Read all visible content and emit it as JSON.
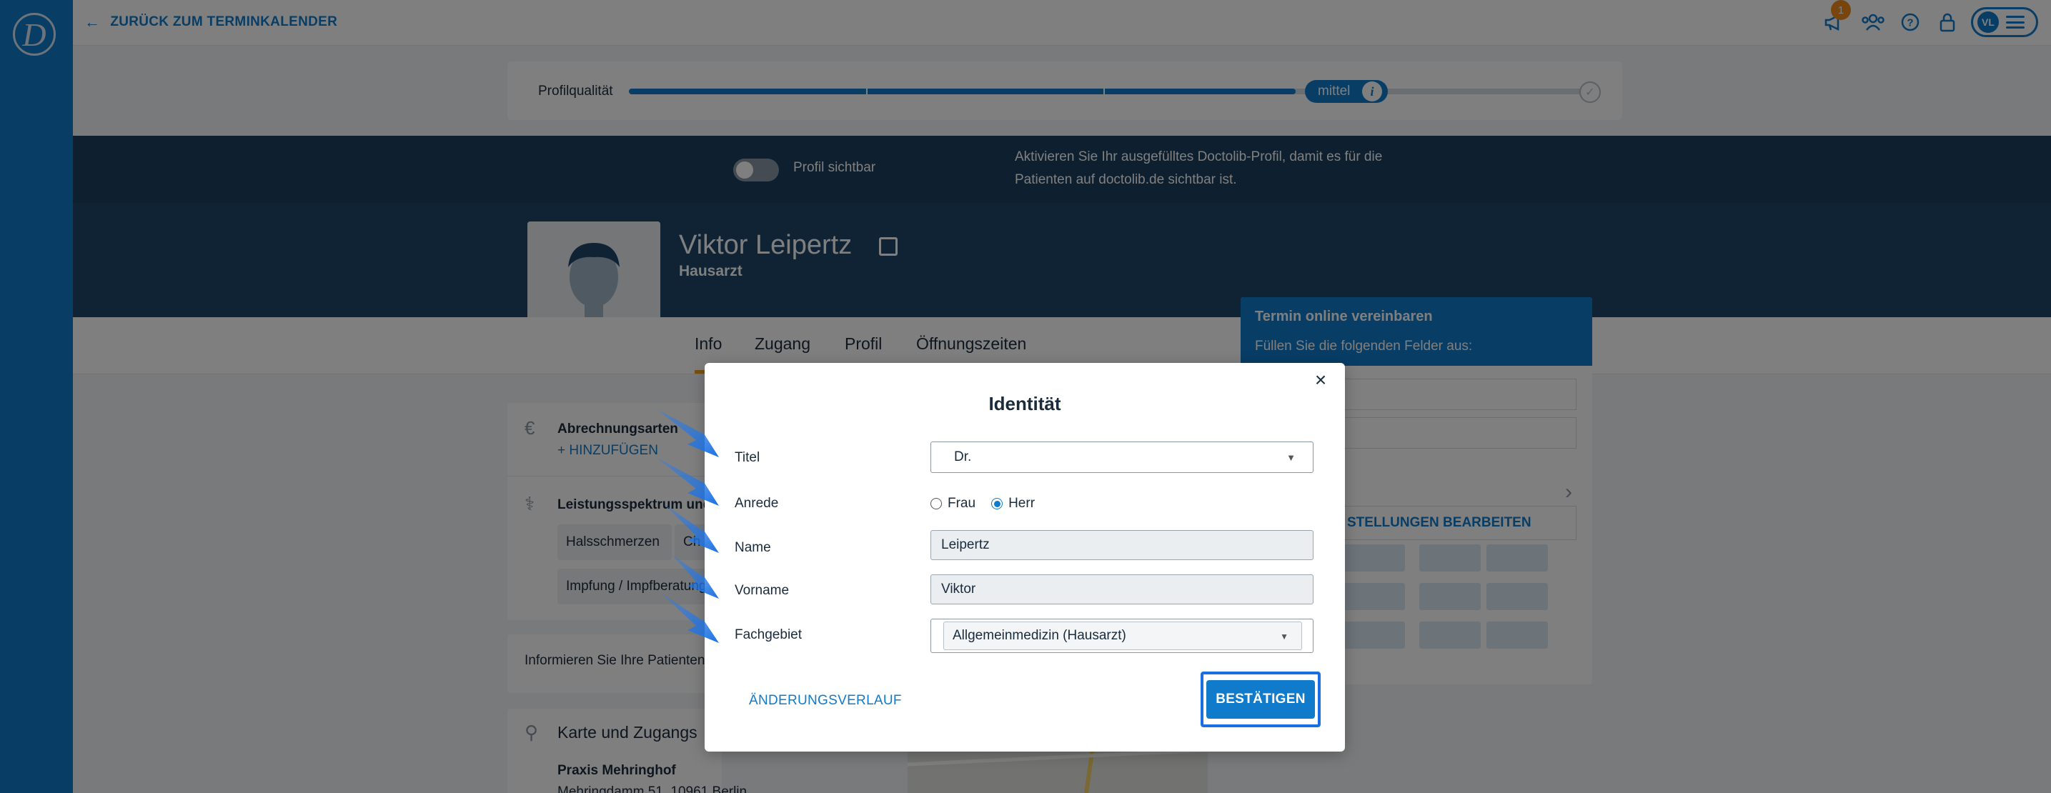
{
  "topbar": {
    "back_label": "ZURÜCK ZUM TERMINKALENDER",
    "notification_count": "1",
    "avatar_initials": "VL",
    "icons": [
      "megaphone-icon",
      "team-icon",
      "help-icon",
      "lock-icon",
      "menu-icon"
    ]
  },
  "quality": {
    "label": "Profilqualität",
    "level_text": "mittel",
    "level_fraction": 0.69
  },
  "visibility": {
    "toggle_label": "Profil sichtbar",
    "toggle_on": false,
    "info_text": "Aktivieren Sie Ihr ausgefülltes Doctolib-Profil, damit es für die Patienten auf doctolib.de sichtbar ist."
  },
  "profile": {
    "name": "Viktor Leipertz",
    "specialty": "Hausarzt"
  },
  "tabs": [
    "Info",
    "Zugang",
    "Profil",
    "Öffnungszeiten"
  ],
  "cards": {
    "billing_title": "Abrechnungsarten",
    "billing_add": "HINZUFÜGEN",
    "services_title": "Leistungsspektrum und",
    "chips": [
      "Halsschmerzen",
      "Ch",
      "Impfung / Impfberatung"
    ],
    "inform_text": "Informieren Sie Ihre Patienten",
    "map_title": "Karte und Zugangs",
    "practice_name": "Praxis Mehringhof",
    "practice_address": "Mehringdamm 51, 10961 Berlin"
  },
  "booking": {
    "title": "Termin online vereinbaren",
    "subtitle": "Füllen Sie die folgenden Felder aus:",
    "button": "STELLUNGEN BEARBEITEN"
  },
  "modal": {
    "title": "Identität",
    "close_glyph": "×",
    "fields": {
      "titel": {
        "label": "Titel",
        "value": "Dr."
      },
      "anrede": {
        "label": "Anrede",
        "options": [
          "Frau",
          "Herr"
        ],
        "selected": "Herr"
      },
      "name": {
        "label": "Name",
        "value": "Leipertz"
      },
      "vorname": {
        "label": "Vorname",
        "value": "Viktor"
      },
      "fachgebiet": {
        "label": "Fachgebiet",
        "value": "Allgemeinmedizin (Hausarzt)"
      }
    },
    "history_link": "ÄNDERUNGSVERLAUF",
    "confirm_button": "BESTÄTIGEN"
  },
  "colors": {
    "brand": "#107acb",
    "navy": "#1d3f5e",
    "accent_orange": "#f08a1c",
    "annotation_arrow": "#1a6fe0"
  }
}
